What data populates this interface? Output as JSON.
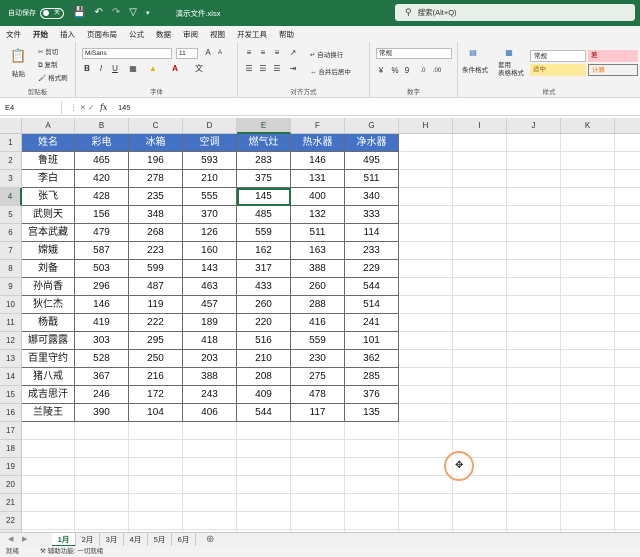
{
  "titlebar": {
    "autosave_label": "自动保存",
    "autosave_state": "关",
    "filename": "演示文件.xlsx",
    "search_placeholder": "搜索(Alt+Q)"
  },
  "menu_tabs": [
    "文件",
    "开始",
    "插入",
    "页面布局",
    "公式",
    "数据",
    "审阅",
    "视图",
    "开发工具",
    "帮助"
  ],
  "active_menu_tab": "开始",
  "ribbon": {
    "clipboard": {
      "paste": "粘贴",
      "cut": "剪切",
      "copy": "复制",
      "format_painter": "格式刷",
      "label": "剪贴板"
    },
    "font": {
      "name": "MiSans",
      "size": "11",
      "label": "字体",
      "bold": "B",
      "italic": "I",
      "underline": "U"
    },
    "alignment": {
      "wrap": "自动换行",
      "merge": "合并后居中",
      "label": "对齐方式"
    },
    "number": {
      "format": "常规",
      "label": "数字"
    },
    "styles": {
      "cond_format": "条件格式",
      "table_format": "套用\n表格格式",
      "style_normal": "常规",
      "style_bad": "差",
      "style_neutral": "适中",
      "style_calc": "计算",
      "label": "样式"
    }
  },
  "formula_bar": {
    "cell_ref": "E4",
    "fx": "fx",
    "value": "145"
  },
  "columns": [
    "A",
    "B",
    "C",
    "D",
    "E",
    "F",
    "G",
    "H",
    "I",
    "J",
    "K"
  ],
  "selected_column": "E",
  "selected_row": 4,
  "row_numbers": [
    1,
    2,
    3,
    4,
    5,
    6,
    7,
    8,
    9,
    10,
    11,
    12,
    13,
    14,
    15,
    16,
    17,
    18,
    19,
    20,
    21,
    22,
    23
  ],
  "table_header": [
    "姓名",
    "彩电",
    "冰箱",
    "空调",
    "燃气灶",
    "热水器",
    "净水器"
  ],
  "table_rows": [
    [
      "鲁班",
      "465",
      "196",
      "593",
      "283",
      "146",
      "495"
    ],
    [
      "李白",
      "420",
      "278",
      "210",
      "375",
      "131",
      "511"
    ],
    [
      "张飞",
      "428",
      "235",
      "555",
      "145",
      "400",
      "340"
    ],
    [
      "武则天",
      "156",
      "348",
      "370",
      "485",
      "132",
      "333"
    ],
    [
      "宫本武藏",
      "479",
      "268",
      "126",
      "559",
      "511",
      "114"
    ],
    [
      "嫦娥",
      "587",
      "223",
      "160",
      "162",
      "163",
      "233"
    ],
    [
      "刘备",
      "503",
      "599",
      "143",
      "317",
      "388",
      "229"
    ],
    [
      "孙尚香",
      "296",
      "487",
      "463",
      "433",
      "260",
      "544"
    ],
    [
      "狄仁杰",
      "146",
      "119",
      "457",
      "260",
      "288",
      "514"
    ],
    [
      "杨戬",
      "419",
      "222",
      "189",
      "220",
      "416",
      "241"
    ],
    [
      "娜可露露",
      "303",
      "295",
      "418",
      "516",
      "559",
      "101"
    ],
    [
      "百里守约",
      "528",
      "250",
      "203",
      "210",
      "230",
      "362"
    ],
    [
      "猪八戒",
      "367",
      "216",
      "388",
      "208",
      "275",
      "285"
    ],
    [
      "成吉思汗",
      "246",
      "172",
      "243",
      "409",
      "478",
      "376"
    ],
    [
      "兰陵王",
      "390",
      "104",
      "406",
      "544",
      "117",
      "135"
    ]
  ],
  "sheet_tabs": [
    "1月",
    "2月",
    "3月",
    "4月",
    "5月",
    "6月"
  ],
  "active_sheet": "1月",
  "statusbar": {
    "ready": "就绪",
    "accessibility": "辅助功能: 一切就绪"
  }
}
